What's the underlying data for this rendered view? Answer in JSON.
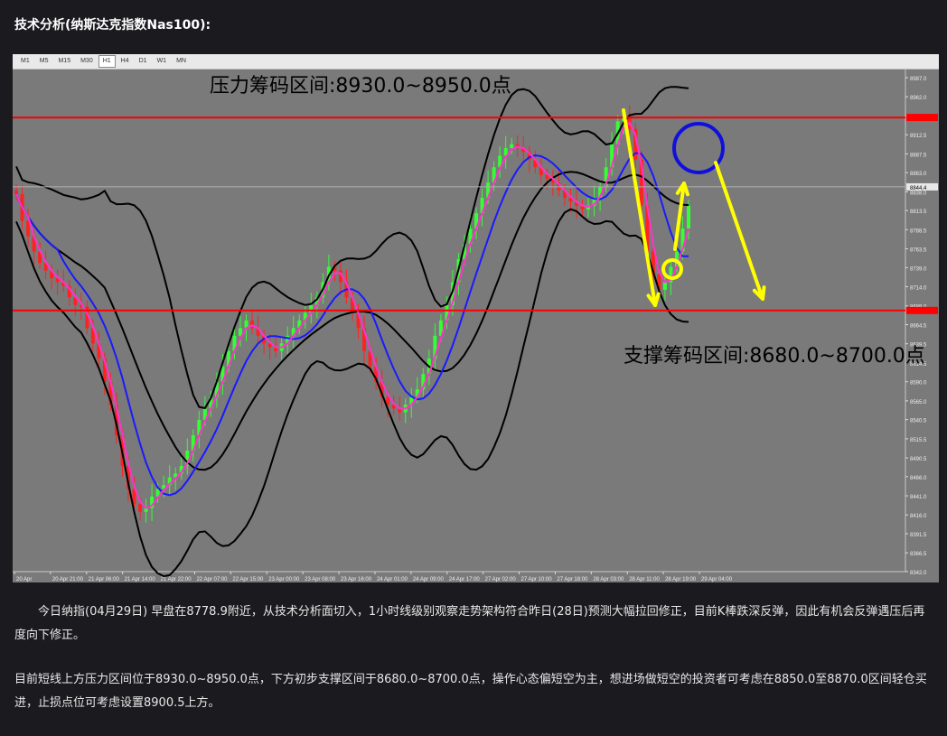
{
  "page": {
    "title": "技术分析(纳斯达克指数Nas100):"
  },
  "toolbar": {
    "timeframes": [
      "M1",
      "M5",
      "M15",
      "M30",
      "H1",
      "H4",
      "D1",
      "W1",
      "MN"
    ],
    "active": "H1"
  },
  "chart_data": {
    "type": "candlestick",
    "instrument": "Nas100",
    "timeframe": "H1",
    "ylim": [
      8342.0,
      8987.0
    ],
    "y_ticks": [
      8987.0,
      8962.0,
      8937.5,
      8912.5,
      8887.5,
      8863.0,
      8838.0,
      8813.5,
      8788.5,
      8763.5,
      8739.0,
      8714.0,
      8689.0,
      8664.5,
      8639.5,
      8614.5,
      8590.0,
      8565.0,
      8540.5,
      8515.5,
      8490.5,
      8466.0,
      8441.0,
      8416.0,
      8391.5,
      8366.5,
      8342.0
    ],
    "y_tick_labels": [
      "8987.0",
      "8962.0",
      "8937.5",
      "8912.5",
      "8887.5",
      "8863.0",
      "8838.0",
      "8813.5",
      "8788.5",
      "8763.5",
      "8739.0",
      "8714.0",
      "8689.0",
      "8664.5",
      "8639.5",
      "8614.5",
      "8590.0",
      "8565.0",
      "8540.5",
      "8515.5",
      "8490.5",
      "8466.0",
      "8441.0",
      "8416.0",
      "8391.5",
      "8366.5",
      "8342.0"
    ],
    "x_tick_labels": [
      "20 Apr",
      "20 Apr 21:00",
      "21 Apr 06:00",
      "21 Apr 14:00",
      "21 Apr 22:00",
      "22 Apr 07:00",
      "22 Apr 15:00",
      "23 Apr 00:00",
      "23 Apr 08:00",
      "23 Apr 16:00",
      "24 Apr 01:00",
      "24 Apr 09:00",
      "24 Apr 17:00",
      "27 Apr 02:00",
      "27 Apr 10:00",
      "27 Apr 18:00",
      "28 Apr 03:00",
      "28 Apr 11:00",
      "28 Apr 19:00",
      "29 Apr 04:00"
    ],
    "horizontal_lines": [
      {
        "label": "resistance",
        "value": 8935.0,
        "color": "#ff0000"
      },
      {
        "label": "support",
        "value": 8683.0,
        "color": "#ff0000"
      }
    ],
    "current_price": 8844.4,
    "current_price_label": "8844.4",
    "close_series": [
      8835,
      8800,
      8780,
      8760,
      8745,
      8735,
      8725,
      8720,
      8715,
      8700,
      8690,
      8688,
      8660,
      8640,
      8620,
      8590,
      8560,
      8520,
      8480,
      8450,
      8430,
      8420,
      8425,
      8440,
      8450,
      8455,
      8465,
      8470,
      8480,
      8500,
      8520,
      8540,
      8555,
      8570,
      8590,
      8610,
      8630,
      8650,
      8660,
      8670,
      8660,
      8650,
      8640,
      8635,
      8630,
      8640,
      8650,
      8660,
      8670,
      8680,
      8690,
      8700,
      8720,
      8740,
      8735,
      8720,
      8700,
      8680,
      8660,
      8630,
      8610,
      8590,
      8570,
      8560,
      8555,
      8550,
      8560,
      8570,
      8580,
      8600,
      8620,
      8650,
      8670,
      8690,
      8720,
      8750,
      8770,
      8790,
      8810,
      8830,
      8850,
      8870,
      8885,
      8895,
      8900,
      8895,
      8890,
      8880,
      8870,
      8860,
      8855,
      8850,
      8840,
      8830,
      8825,
      8820,
      8815,
      8820,
      8830,
      8845,
      8870,
      8900,
      8930,
      8935,
      8920,
      8880,
      8820,
      8760,
      8730,
      8710,
      8720,
      8740,
      8760,
      8790,
      8820
    ],
    "series": [
      {
        "name": "MA fast",
        "color": "#ff33cc"
      },
      {
        "name": "MA slow",
        "color": "#1a1aff"
      },
      {
        "name": "Bollinger",
        "color": "#000000"
      }
    ],
    "annotations": [
      {
        "text": "压力筹码区间:8930.0~8950.0点"
      },
      {
        "text": "支撑筹码区间:8680.0~8700.0点"
      }
    ],
    "drawn_shapes": [
      {
        "shape": "circle",
        "color": "#1010dd"
      },
      {
        "shape": "circle",
        "color": "#ffff00"
      },
      {
        "shape": "arrow",
        "color": "#ffff00"
      }
    ]
  },
  "article": {
    "paragraph1": "今日纳指(04月29日) 早盘在8778.9附近，从技术分析面切入，1小时线级别观察走势架构符合昨日(28日)预测大幅拉回修正，目前K棒跌深反弹，因此有机会反弹遇压后再度向下修正。",
    "paragraph2": "目前短线上方压力区间位于8930.0~8950.0点，下方初步支撑区间于8680.0~8700.0点，操作心态偏短空为主，想进场做短空的投资者可考虑在8850.0至8870.0区间轻仓买进，止损点位可考虑设置8900.5上方。"
  }
}
